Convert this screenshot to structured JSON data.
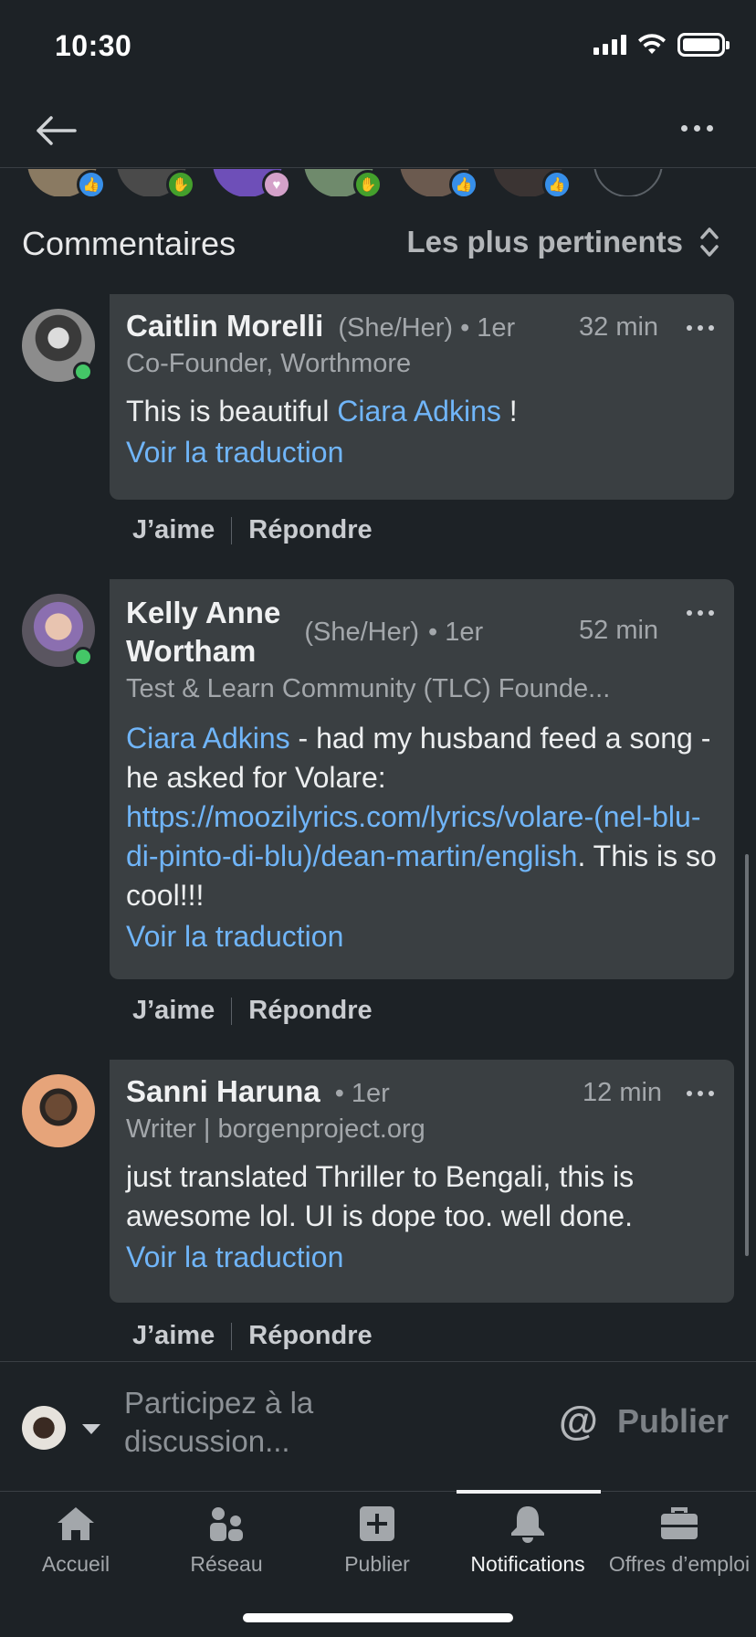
{
  "status_bar": {
    "time": "10:30"
  },
  "comments_header": {
    "title": "Commentaires",
    "sort": "Les plus pertinents"
  },
  "comments": [
    {
      "name": "Caitlin Morelli",
      "pronouns": "(She/Her)",
      "degree": "• 1er",
      "time": "32 min",
      "headline": "Co-Founder, Worthmore",
      "text_before": "This is beautiful ",
      "mention": "Ciara Adkins",
      "text_after": " !",
      "translate": "Voir la traduction",
      "like": "J’aime",
      "reply": "Répondre"
    },
    {
      "name_line1": "Kelly Anne",
      "name_line2": "Wortham",
      "pronouns": "(She/Her)",
      "degree": "• 1er",
      "time": "52 min",
      "headline": "Test & Learn Community (TLC) Founde...",
      "mention": "Ciara Adkins",
      "text_mid": " - had my husband feed a song - he asked for Volare: ",
      "link": "https://moozilyrics.com/lyrics/volare-(nel-blu-di-pinto-di-blu)/dean-martin/english",
      "text_end": ". This is so cool!!!",
      "translate": "Voir la traduction",
      "like": "J’aime",
      "reply": "Répondre"
    },
    {
      "name": "Sanni Haruna",
      "degree": "• 1er",
      "time": "12 min",
      "headline": "Writer | borgenproject.org",
      "text": "just translated Thriller to Bengali, this is awesome lol. UI is dope too. well done.",
      "translate": "Voir la traduction",
      "like": "J’aime",
      "reply": "Répondre"
    }
  ],
  "composer": {
    "placeholder": "Participez à la discussion...",
    "at_symbol": "@",
    "post": "Publier"
  },
  "tabs": [
    {
      "label": "Accueil",
      "icon": "home-icon"
    },
    {
      "label": "Réseau",
      "icon": "network-icon"
    },
    {
      "label": "Publier",
      "icon": "post-icon"
    },
    {
      "label": "Notifications",
      "icon": "bell-icon",
      "active": true
    },
    {
      "label": "Offres d’emploi",
      "icon": "briefcase-icon"
    }
  ],
  "colors": {
    "background": "#1d2226",
    "bubble": "#3a3f42",
    "link": "#70b5f9",
    "online": "#44c767",
    "like": "#378fe9",
    "clap": "#44a02c"
  }
}
